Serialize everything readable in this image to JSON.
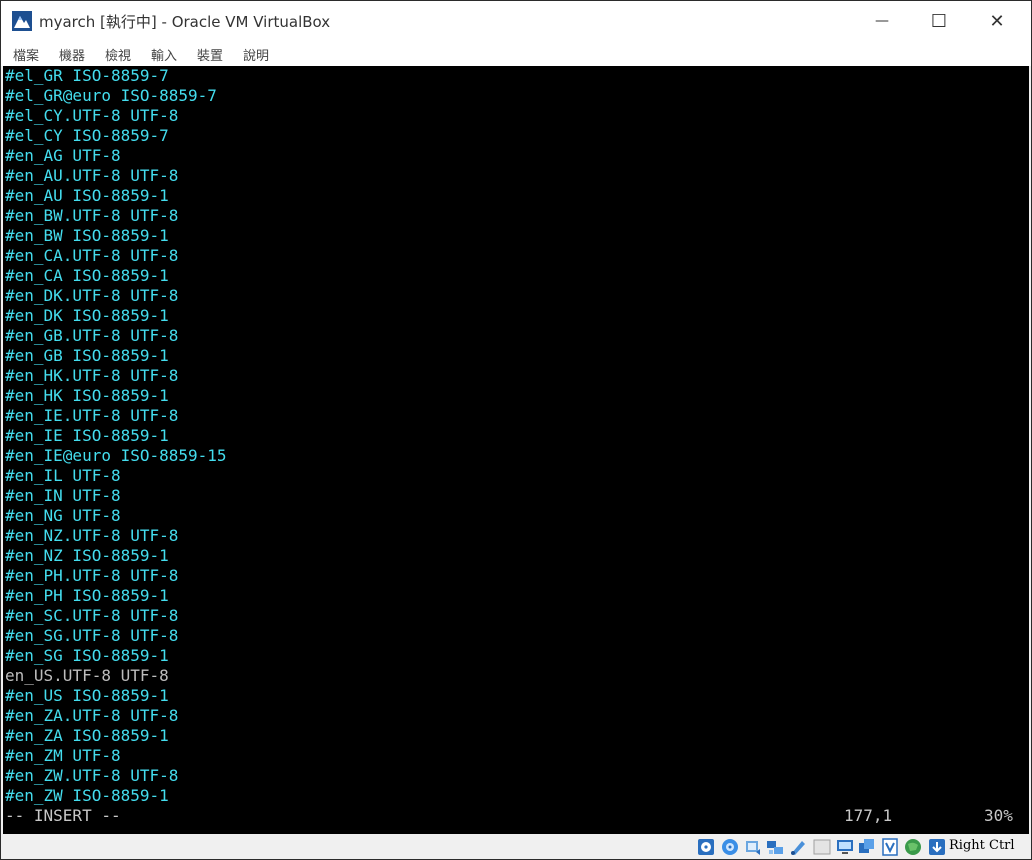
{
  "window": {
    "title": "myarch [執行中] - Oracle VM VirtualBox",
    "controls": {
      "minimize": "—",
      "maximize": "☐",
      "close": "✕"
    }
  },
  "menu": [
    "檔案",
    "機器",
    "檢視",
    "輸入",
    "裝置",
    "說明"
  ],
  "console": {
    "lines": [
      "#el_GR ISO-8859-7",
      "#el_GR@euro ISO-8859-7",
      "#el_CY.UTF-8 UTF-8",
      "#el_CY ISO-8859-7",
      "#en_AG UTF-8",
      "#en_AU.UTF-8 UTF-8",
      "#en_AU ISO-8859-1",
      "#en_BW.UTF-8 UTF-8",
      "#en_BW ISO-8859-1",
      "#en_CA.UTF-8 UTF-8",
      "#en_CA ISO-8859-1",
      "#en_DK.UTF-8 UTF-8",
      "#en_DK ISO-8859-1",
      "#en_GB.UTF-8 UTF-8",
      "#en_GB ISO-8859-1",
      "#en_HK.UTF-8 UTF-8",
      "#en_HK ISO-8859-1",
      "#en_IE.UTF-8 UTF-8",
      "#en_IE ISO-8859-1",
      "#en_IE@euro ISO-8859-15",
      "#en_IL UTF-8",
      "#en_IN UTF-8",
      "#en_NG UTF-8",
      "#en_NZ.UTF-8 UTF-8",
      "#en_NZ ISO-8859-1",
      "#en_PH.UTF-8 UTF-8",
      "#en_PH ISO-8859-1",
      "#en_SC.UTF-8 UTF-8",
      "#en_SG.UTF-8 UTF-8",
      "#en_SG ISO-8859-1",
      "en_US.UTF-8 UTF-8",
      "#en_US ISO-8859-1",
      "#en_ZA.UTF-8 UTF-8",
      "#en_ZA ISO-8859-1",
      "#en_ZM UTF-8",
      "#en_ZW.UTF-8 UTF-8",
      "#en_ZW ISO-8859-1"
    ],
    "mode": "-- INSERT --",
    "cursor_position": "177,1",
    "scroll_percent": "30%"
  },
  "statusbar": {
    "icons": [
      "hard-disk-icon",
      "optical-drive-icon",
      "audio-icon",
      "network-icon",
      "usb-icon",
      "shared-folders-icon",
      "display-icon",
      "video-capture-icon",
      "virtualization-icon",
      "guest-os-icon",
      "mouse-integration-icon",
      "keyboard-icon"
    ],
    "host_key": "Right Ctrl"
  },
  "colors": {
    "console_bg": "#000000",
    "comment_text": "#44ddee",
    "plain_text": "#bdbdbd"
  }
}
